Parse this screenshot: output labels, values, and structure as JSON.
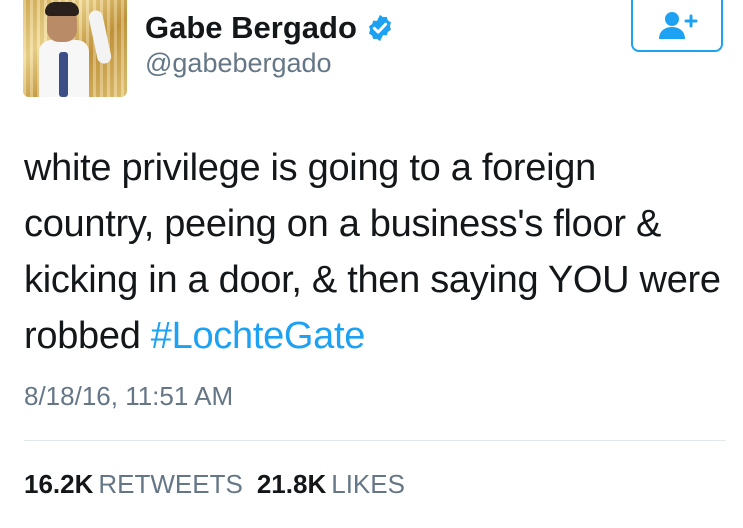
{
  "tweet": {
    "author": {
      "display_name": "Gabe Bergado",
      "handle": "@gabebergado",
      "verified_icon": "verified-badge-icon",
      "avatar": "profile-photo"
    },
    "follow_button_icon": "add-user-icon",
    "text": "white privilege is going to a foreign country, peeing on a business's floor & kicking in a door, & then saying YOU were robbed ",
    "hashtag": "#LochteGate",
    "timestamp": "8/18/16, 11:51 AM",
    "stats": {
      "retweets_count": "16.2K",
      "retweets_label": "RETWEETS",
      "likes_count": "21.8K",
      "likes_label": "LIKES"
    }
  },
  "colors": {
    "accent": "#1da1f2",
    "text": "#14171a",
    "secondary": "#657786",
    "divider": "#e1e8ed"
  }
}
